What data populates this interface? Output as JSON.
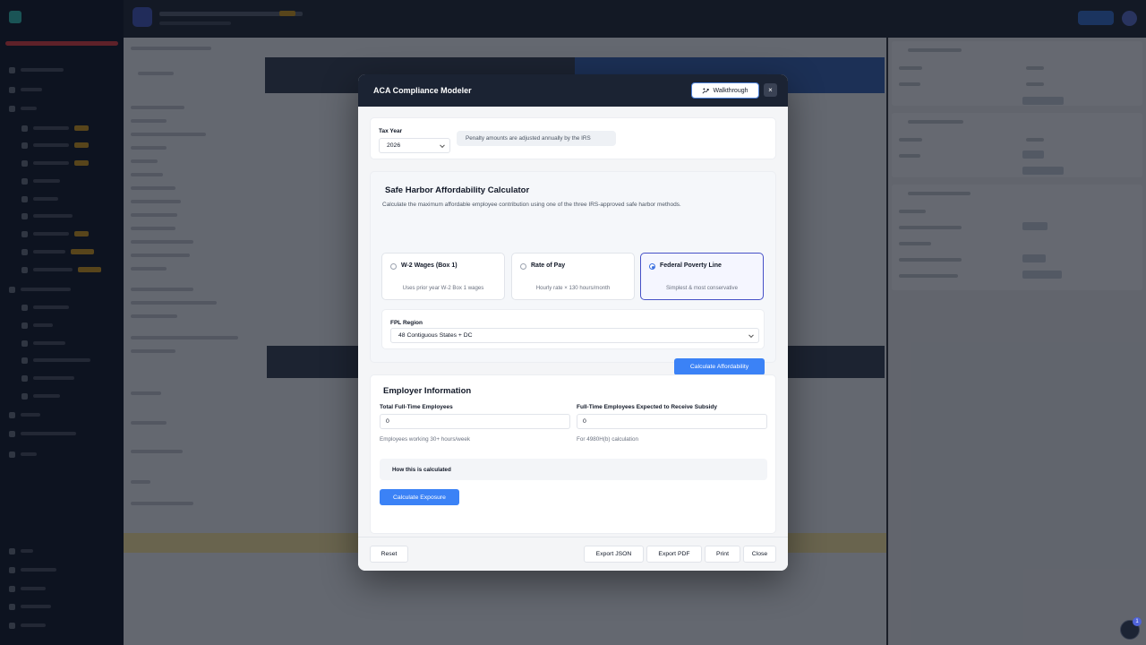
{
  "modal": {
    "title": "ACA Compliance Modeler",
    "walkthrough_label": "Walkthrough",
    "close_symbol": "×",
    "tax_year": {
      "label": "Tax Year",
      "value": "2026",
      "note": "Penalty amounts are adjusted annually by the IRS"
    },
    "safe_harbor": {
      "title": "Safe Harbor Affordability Calculator",
      "description": "Calculate the maximum affordable employee contribution using one of the three IRS-approved safe harbor methods.",
      "options": [
        {
          "title": "W-2 Wages (Box 1)",
          "subtitle": "Uses prior year W-2 Box 1 wages",
          "selected": false
        },
        {
          "title": "Rate of Pay",
          "subtitle": "Hourly rate × 130 hours/month",
          "selected": false
        },
        {
          "title": "Federal Poverty Line",
          "subtitle": "Simplest & most conservative",
          "selected": true
        }
      ],
      "fpl_region_label": "FPL Region",
      "fpl_region_value": "48 Contiguous States + DC",
      "calculate_label": "Calculate Affordability"
    },
    "employer": {
      "title": "Employer Information",
      "total_ft_label": "Total Full-Time Employees",
      "total_ft_value": "0",
      "total_ft_hint": "Employees working 30+ hours/week",
      "subsidy_label": "Full-Time Employees Expected to Receive Subsidy",
      "subsidy_value": "0",
      "subsidy_hint": "For 4980H(b) calculation",
      "how_calculated": "How this is calculated",
      "calculate_label": "Calculate Exposure"
    },
    "footer": {
      "reset": "Reset",
      "export_json": "Export JSON",
      "export_pdf": "Export PDF",
      "print": "Print",
      "close": "Close"
    }
  },
  "notifications": {
    "count": "1"
  },
  "colors": {
    "accent": "#3b82f6",
    "selected_border": "#4650c7",
    "header": "#1b2333"
  }
}
